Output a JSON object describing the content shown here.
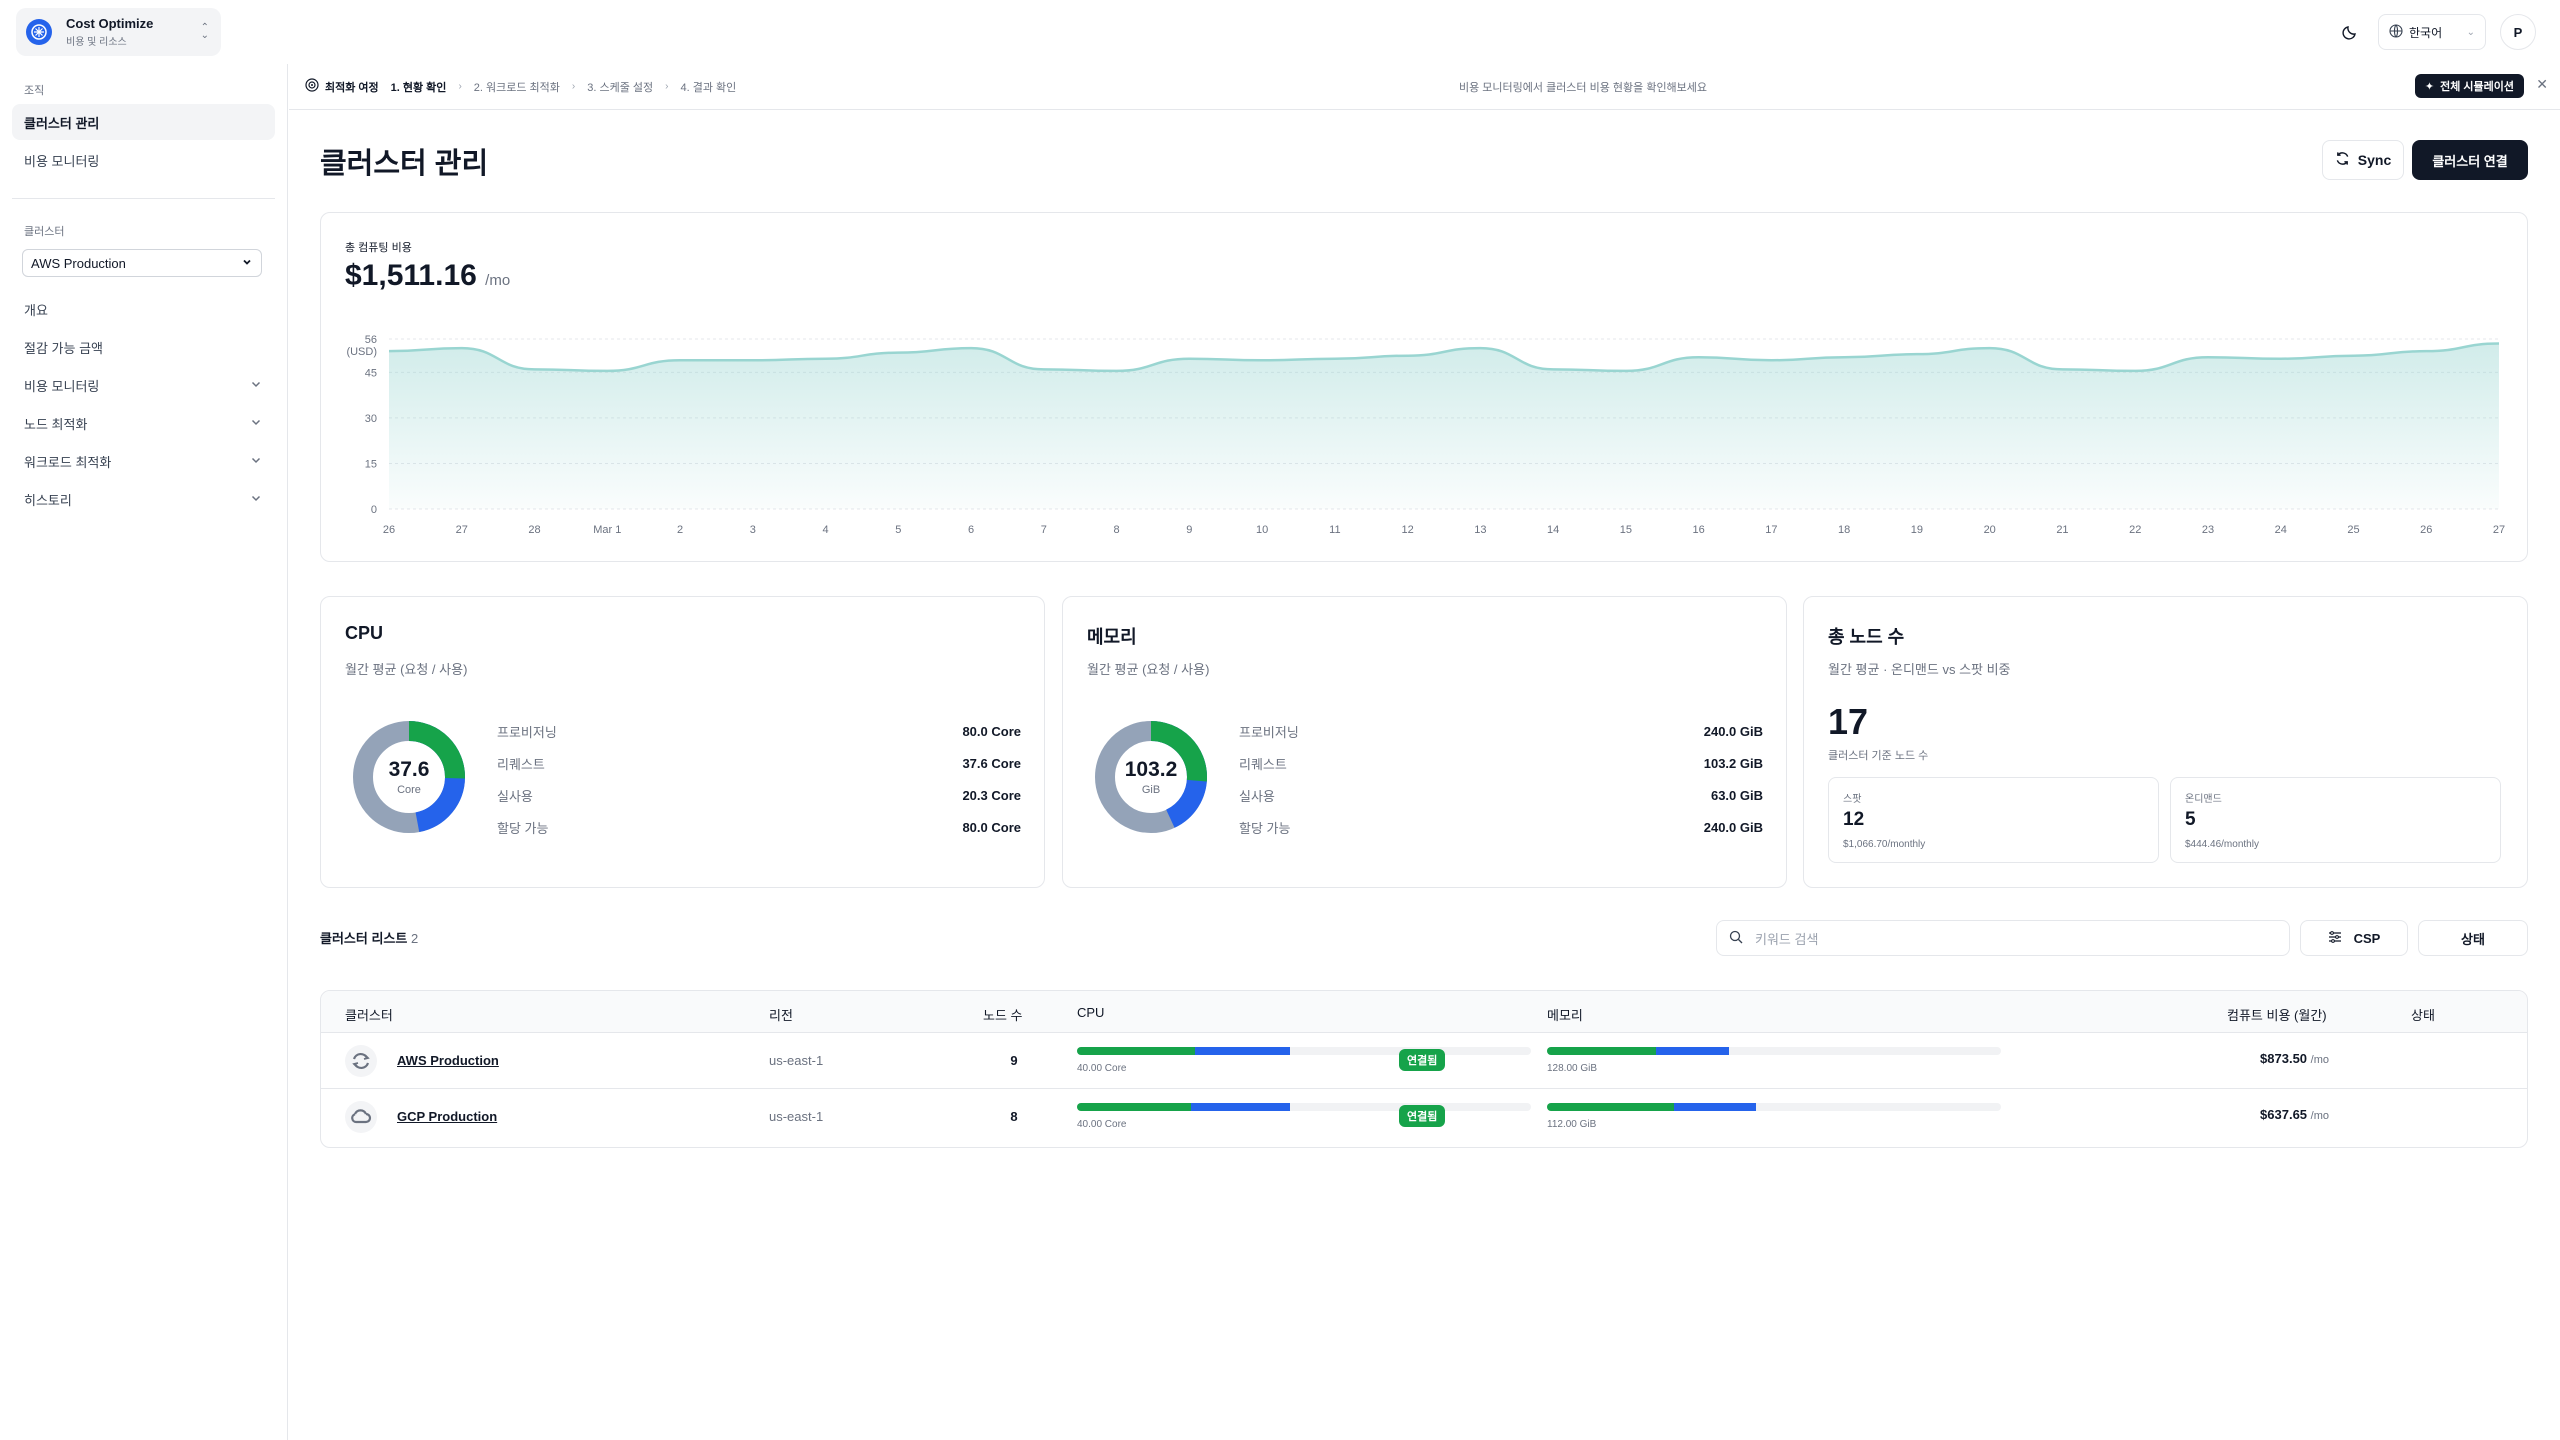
{
  "org": {
    "name": "Cost Optimize",
    "subtitle": "비용 및 리소스"
  },
  "topbar": {
    "language": "한국어",
    "avatar_initial": "P"
  },
  "sidebar": {
    "section_org": "조직",
    "org_items": [
      {
        "label": "클러스터 관리",
        "active": true
      },
      {
        "label": "비용 모니터링",
        "active": false
      }
    ],
    "section_cluster": "클러스터",
    "cluster_select": "AWS Production",
    "cluster_items": [
      {
        "label": "개요"
      },
      {
        "label": "절감 가능 금액"
      },
      {
        "label": "비용 모니터링"
      },
      {
        "label": "노드 최적화"
      },
      {
        "label": "워크로드 최적화"
      },
      {
        "label": "히스토리"
      }
    ]
  },
  "journey": {
    "title": "최적화 여정",
    "steps": [
      "1. 현황 확인",
      "2. 워크로드 최적화",
      "3. 스케줄 설정",
      "4. 결과 확인"
    ],
    "message": "비용 모니터링에서 클러스터 비용 현황을 확인해보세요",
    "simulation_label": "전체 시뮬레이션"
  },
  "page": {
    "title": "클러스터 관리",
    "sync_label": "Sync",
    "connect_label": "클러스터 연결"
  },
  "cost": {
    "label": "총 컴퓨팅 비용",
    "value": "$1,511.16",
    "unit": "/mo"
  },
  "chart_data": {
    "type": "area",
    "unit_label": "(USD)",
    "y_ticks": [
      "0",
      "15",
      "30",
      "45",
      "56"
    ],
    "ylim": [
      0,
      56
    ],
    "x": [
      "26",
      "27",
      "28",
      "Mar 1",
      "2",
      "3",
      "4",
      "5",
      "6",
      "7",
      "8",
      "9",
      "10",
      "11",
      "12",
      "13",
      "14",
      "15",
      "16",
      "17",
      "18",
      "19",
      "20",
      "21",
      "22",
      "23",
      "24",
      "25",
      "26",
      "27"
    ],
    "values": [
      52,
      53,
      46,
      45.5,
      49,
      49,
      49.5,
      51.5,
      53,
      46,
      45.5,
      49.5,
      49,
      49.5,
      50.5,
      53,
      46,
      45.5,
      50,
      49,
      50,
      51,
      53,
      46,
      45.5,
      50,
      49.5,
      50.5,
      52,
      54.5
    ],
    "color": "#99d5d1"
  },
  "cpu": {
    "title": "CPU",
    "subtitle": "월간 평균 (요청 / 사용)",
    "center_value": "37.6",
    "center_unit": "Core",
    "rows": [
      {
        "k": "프로비저닝",
        "v": "80.0 Core"
      },
      {
        "k": "리퀘스트",
        "v": "37.6 Core"
      },
      {
        "k": "실사용",
        "v": "20.3 Core"
      },
      {
        "k": "할당 가능",
        "v": "80.0 Core"
      }
    ],
    "used_fraction": 0.254,
    "requested_fraction": 0.47
  },
  "memory": {
    "title": "메모리",
    "subtitle": "월간 평균 (요청 / 사용)",
    "center_value": "103.2",
    "center_unit": "GiB",
    "rows": [
      {
        "k": "프로비저닝",
        "v": "240.0 GiB"
      },
      {
        "k": "리퀘스트",
        "v": "103.2 GiB"
      },
      {
        "k": "실사용",
        "v": "63.0 GiB"
      },
      {
        "k": "할당 가능",
        "v": "240.0 GiB"
      }
    ],
    "used_fraction": 0.2625,
    "requested_fraction": 0.43
  },
  "nodes": {
    "title": "총 노드 수",
    "subtitle": "월간 평균 · 온디맨드 vs 스팟 비중",
    "total": "17",
    "desc": "클러스터 기준 노드 수",
    "spot": {
      "label": "스팟",
      "count": "12",
      "cost": "$1,066.70/monthly"
    },
    "ondemand": {
      "label": "온디맨드",
      "count": "5",
      "cost": "$444.46/monthly"
    }
  },
  "list": {
    "title": "클러스터 리스트",
    "count": "2",
    "search_placeholder": "키워드 검색",
    "filter_csp": "CSP",
    "filter_status": "상태",
    "headers": {
      "cluster": "클러스터",
      "region": "리전",
      "nodes": "노드 수",
      "cpu": "CPU",
      "memory": "메모리",
      "cost": "컴퓨트 비용 (월간)",
      "status": "상태"
    },
    "rows": [
      {
        "name": "AWS Production",
        "region": "us-east-1",
        "nodes": "9",
        "cpu_label": "40.00 Core",
        "cpu_used": 0.26,
        "cpu_req": 0.47,
        "mem_label": "128.00 GiB",
        "mem_used": 0.24,
        "mem_req": 0.4,
        "cost": "$873.50",
        "cost_unit": "/mo",
        "status": "연결됨"
      },
      {
        "name": "GCP Production",
        "region": "us-east-1",
        "nodes": "8",
        "cpu_label": "40.00 Core",
        "cpu_used": 0.25,
        "cpu_req": 0.47,
        "mem_label": "112.00 GiB",
        "mem_used": 0.28,
        "mem_req": 0.46,
        "cost": "$637.65",
        "cost_unit": "/mo",
        "status": "연결됨"
      }
    ]
  },
  "colors": {
    "used": "#16a34a",
    "requested": "#2563eb",
    "provisioned": "#94a3b8",
    "accent": "#111827"
  }
}
